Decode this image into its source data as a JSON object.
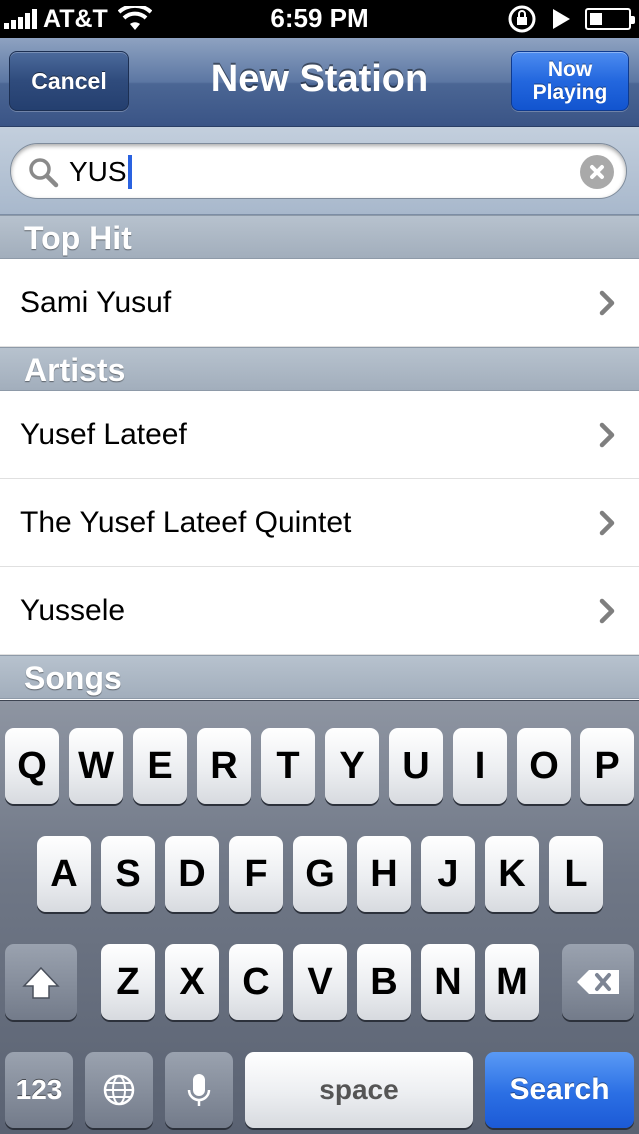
{
  "status_bar": {
    "carrier": "AT&T",
    "time": "6:59 PM",
    "icons": [
      "signal-bars-icon",
      "wifi-icon",
      "rotation-lock-icon",
      "play-icon",
      "battery-icon"
    ]
  },
  "nav": {
    "title": "New Station",
    "cancel_label": "Cancel",
    "now_playing_line1": "Now",
    "now_playing_line2": "Playing"
  },
  "search": {
    "value": "YUS"
  },
  "sections": [
    {
      "header": "Top Hit",
      "items": [
        "Sami Yusuf"
      ]
    },
    {
      "header": "Artists",
      "items": [
        "Yusef Lateef",
        "The Yusef Lateef Quintet",
        "Yussele"
      ]
    },
    {
      "header": "Songs",
      "items": []
    }
  ],
  "keyboard": {
    "row1": [
      "Q",
      "W",
      "E",
      "R",
      "T",
      "Y",
      "U",
      "I",
      "O",
      "P"
    ],
    "row2": [
      "A",
      "S",
      "D",
      "F",
      "G",
      "H",
      "J",
      "K",
      "L"
    ],
    "row3": [
      "Z",
      "X",
      "C",
      "V",
      "B",
      "N",
      "M"
    ],
    "numbers_label": "123",
    "space_label": "space",
    "search_label": "Search"
  },
  "colors": {
    "nav_blue": "#3a5486",
    "action_blue": "#2367de",
    "caret": "#2a62e0"
  }
}
